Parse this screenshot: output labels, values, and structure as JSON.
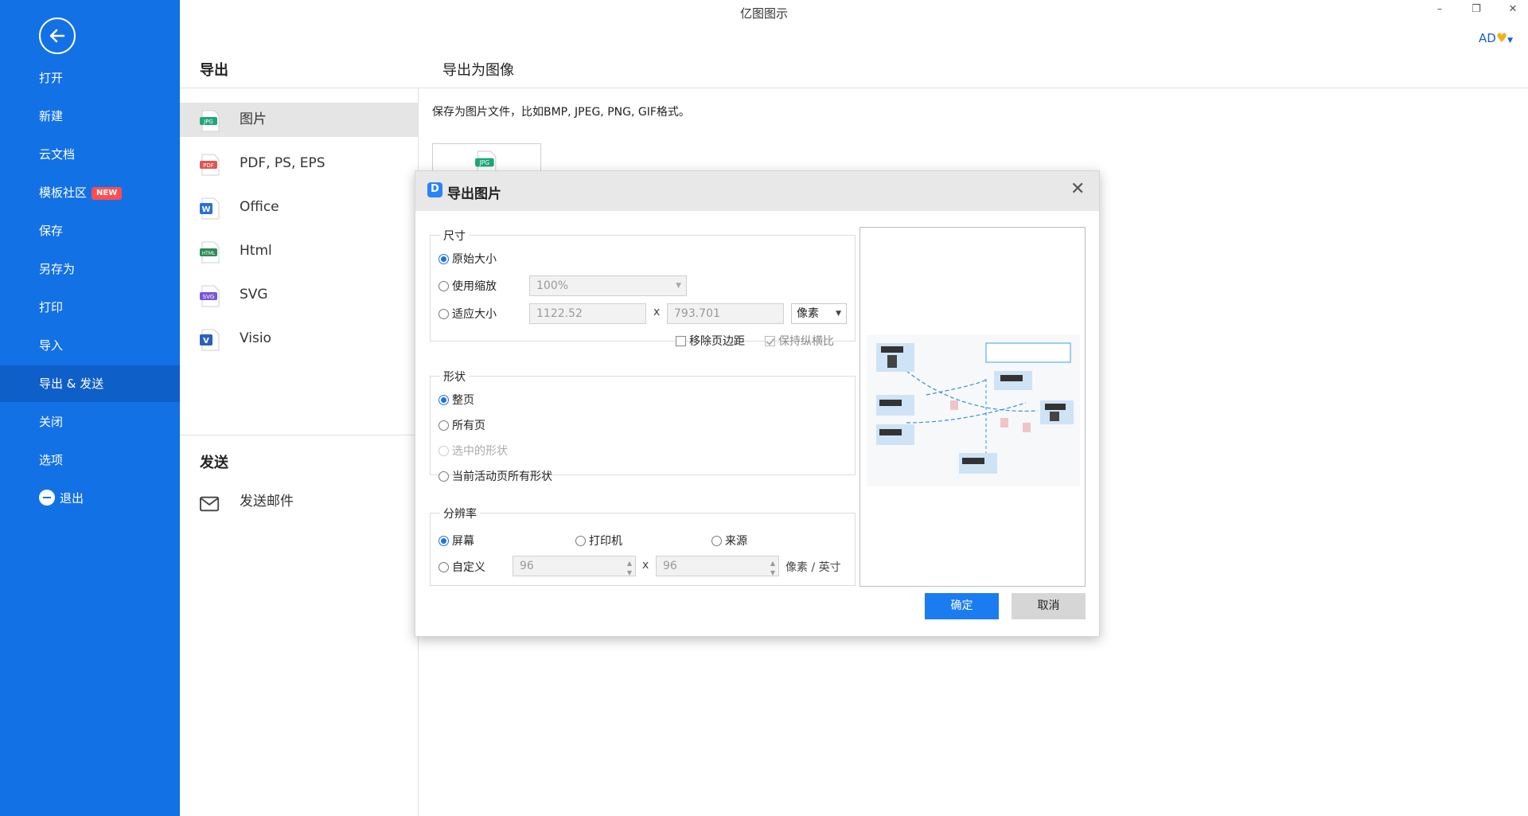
{
  "app": {
    "title": "亿图图示"
  },
  "window_controls": {
    "minimize": "–",
    "restore": "❐",
    "close": "✕"
  },
  "user": {
    "label": "AD"
  },
  "sidebar": {
    "items": [
      {
        "label": "打开"
      },
      {
        "label": "新建"
      },
      {
        "label": "云文档"
      },
      {
        "label": "模板社区",
        "badge": "NEW"
      },
      {
        "label": "保存"
      },
      {
        "label": "另存为"
      },
      {
        "label": "打印"
      },
      {
        "label": "导入"
      },
      {
        "label": "导出 & 发送",
        "active": true
      },
      {
        "label": "关闭"
      },
      {
        "label": "选项"
      },
      {
        "label": "退出"
      }
    ]
  },
  "export_panel": {
    "title": "导出",
    "items": [
      {
        "label": "图片",
        "icon_text": "JPG",
        "icon_color": "#1fa67a",
        "active": true
      },
      {
        "label": "PDF, PS, EPS",
        "icon_text": "PDF",
        "icon_color": "#e25454"
      },
      {
        "label": "Office",
        "icon_text": "W",
        "icon_color": "#2b6fd6"
      },
      {
        "label": "Html",
        "icon_text": "HTML",
        "icon_color": "#2e8b57"
      },
      {
        "label": "SVG",
        "icon_text": "SVG",
        "icon_color": "#7b55d6"
      },
      {
        "label": "Visio",
        "icon_text": "V",
        "icon_color": "#2b5fbd"
      }
    ],
    "send_title": "发送",
    "send_items": [
      {
        "label": "发送邮件"
      }
    ]
  },
  "right_panel": {
    "title": "导出为图像",
    "description": "保存为图片文件，比如BMP, JPEG, PNG, GIF格式。",
    "card_icon_text": "JPG"
  },
  "dialog": {
    "title": "导出图片",
    "size_group": {
      "label": "尺寸",
      "original": "原始大小",
      "use_scale": "使用缩放",
      "scale_value": "100%",
      "fit_size": "适应大小",
      "width": "1122.52",
      "times": "x",
      "height": "793.701",
      "unit": "像素",
      "remove_margin": "移除页边距",
      "keep_ratio": "保持纵横比"
    },
    "shape_group": {
      "label": "形状",
      "whole_page": "整页",
      "all_pages": "所有页",
      "selected_shapes": "选中的形状",
      "current_page_shapes": "当前活动页所有形状"
    },
    "resolution_group": {
      "label": "分辨率",
      "screen": "屏幕",
      "printer": "打印机",
      "source": "来源",
      "custom": "自定义",
      "dpi_x": "96",
      "times": "x",
      "dpi_y": "96",
      "unit": "像素 / 英寸"
    },
    "ok": "确定",
    "cancel": "取消"
  },
  "colors": {
    "sidebar_bg": "#1371e6",
    "sidebar_active": "#0f5fc8",
    "primary_button": "#1a7cf0"
  }
}
